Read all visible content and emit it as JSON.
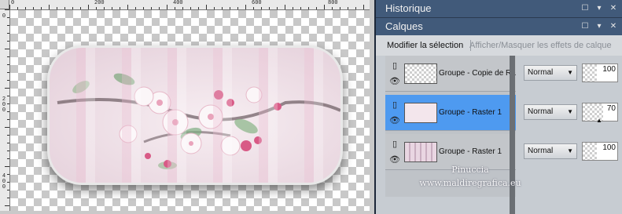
{
  "rulers": {
    "top_labels": [
      "0",
      "200",
      "400",
      "600",
      "800"
    ],
    "left_labels": [
      "0",
      "200",
      "400"
    ]
  },
  "panels": {
    "historique": {
      "title": "Historique"
    },
    "calques": {
      "title": "Calques",
      "toolbar": {
        "modify_selection": "Modifier la sélection",
        "toggle_effects": "Afficher/Masquer les effets de calque"
      },
      "layers": [
        {
          "name": "Groupe - Copie de Ra",
          "blend_mode": "Normal",
          "opacity": 100,
          "selected": false
        },
        {
          "name": "Groupe - Raster 1",
          "blend_mode": "Normal",
          "opacity": 70,
          "selected": true
        },
        {
          "name": "Groupe - Raster 1",
          "blend_mode": "Normal",
          "opacity": 100,
          "selected": false
        }
      ]
    }
  },
  "watermark": {
    "line1": "Pinuccia",
    "line2": "www.maldiregrafica.eu"
  },
  "colors": {
    "panel_header": "#415a7a",
    "selection": "#4e9af0",
    "workspace": "#2f4a6e"
  }
}
